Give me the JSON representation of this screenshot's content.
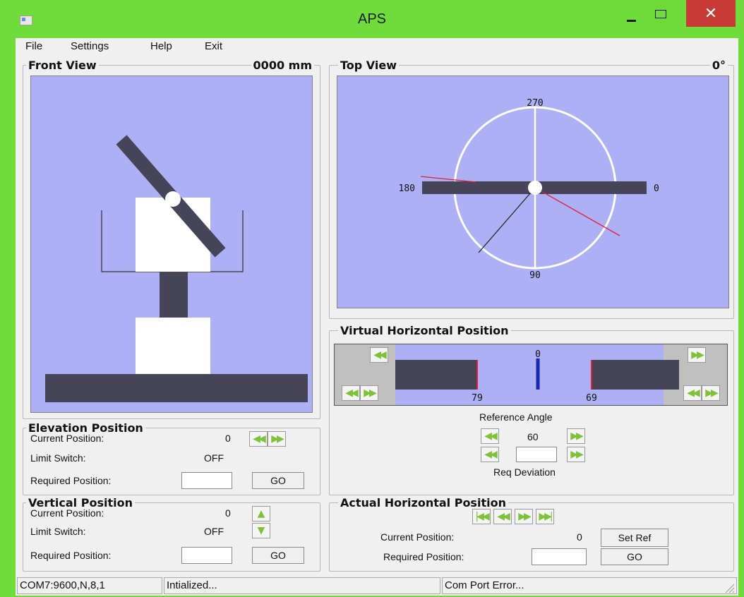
{
  "window": {
    "title": "APS"
  },
  "menu": [
    "File",
    "Settings",
    "Help",
    "Exit"
  ],
  "front_view": {
    "title": "Front View",
    "readout": "0000 mm"
  },
  "top_view": {
    "title": "Top View",
    "readout": "0°",
    "labels": {
      "top": "270",
      "left": "180",
      "right": "0",
      "bottom": "90"
    }
  },
  "virtual_horizontal": {
    "title": "Virtual Horizontal Position",
    "center_value": "0",
    "left_value": "79",
    "right_value": "69",
    "reference_angle_label": "Reference Angle",
    "reference_angle_value": "60",
    "req_deviation_label": "Req Deviation",
    "req_deviation_value": ""
  },
  "elevation": {
    "title": "Elevation Position",
    "current_label": "Current Position:",
    "current_value": "0",
    "limit_label": "Limit Switch:",
    "limit_value": "OFF",
    "required_label": "Required Position:",
    "required_value": "",
    "go_label": "GO"
  },
  "vertical": {
    "title": "Vertical Position",
    "current_label": "Current Position:",
    "current_value": "0",
    "limit_label": "Limit Switch:",
    "limit_value": "OFF",
    "required_label": "Required Position:",
    "required_value": "",
    "go_label": "GO"
  },
  "actual_horizontal": {
    "title": "Actual Horizontal Position",
    "current_label": "Current Position:",
    "current_value": "0",
    "required_label": "Required Position:",
    "required_value": "",
    "set_ref_label": "Set Ref",
    "go_label": "GO"
  },
  "status": {
    "port": "COM7:9600,N,8,1",
    "state": "Intialized...",
    "error": "Com Port Error..."
  },
  "colors": {
    "frame": "#6fdc3c",
    "canvas": "#aeb0f6",
    "dark_bar": "#464458",
    "red_marker": "#e0203a",
    "blue_marker": "#1a28b0",
    "close": "#c73a35"
  }
}
